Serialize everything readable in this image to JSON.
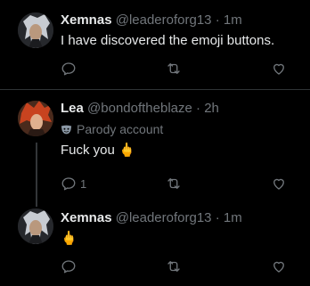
{
  "tweets": [
    {
      "name": "Xemnas",
      "handle": "@leaderoforg13",
      "separator": "·",
      "time": "1m",
      "text": "I have discovered the emoji buttons.",
      "reply_count": ""
    },
    {
      "name": "Lea",
      "handle": "@bondoftheblaze",
      "separator": "·",
      "time": "2h",
      "parody_label": "Parody account",
      "text": "Fuck you",
      "emoji": "🖕",
      "reply_count": "1"
    },
    {
      "name": "Xemnas",
      "handle": "@leaderoforg13",
      "separator": "·",
      "time": "1m",
      "text": "",
      "emoji": "🖕",
      "reply_count": ""
    }
  ],
  "colors": {
    "background": "#000000",
    "text": "#e7e9ea",
    "muted": "#71767b",
    "divider": "#2f3336"
  },
  "icons": [
    "reply-icon",
    "retweet-icon",
    "like-icon",
    "parody-mask-icon"
  ]
}
